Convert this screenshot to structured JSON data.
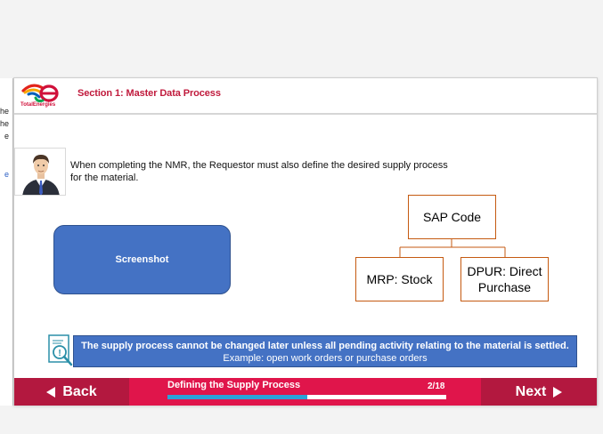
{
  "left_panel": {
    "fragments": [
      "he",
      "he",
      "e",
      "e"
    ]
  },
  "header": {
    "logo_text": "TotalEnergies",
    "section_title": "Section 1: Master Data Process"
  },
  "content": {
    "intro": "When completing the NMR, the Requestor must also define the desired supply process for the material.",
    "screenshot_label": "Screenshot"
  },
  "diagram": {
    "root": "SAP Code",
    "children": [
      "MRP: Stock",
      "DPUR: Direct Purchase"
    ]
  },
  "note": {
    "line1": "The supply process  cannot be changed later unless all pending activity relating to the material is settled.",
    "line2": "Example: open work orders or purchase orders"
  },
  "footer": {
    "back_label": "Back",
    "next_label": "Next",
    "title": "Defining the Supply Process",
    "page": "2/18",
    "progress": 0.5
  },
  "colors": {
    "brand_red": "#e0154b",
    "button_red": "#b3183f",
    "blue_box": "#4472c4",
    "node_border": "#c55a11",
    "progress": "#2aa3d8"
  }
}
